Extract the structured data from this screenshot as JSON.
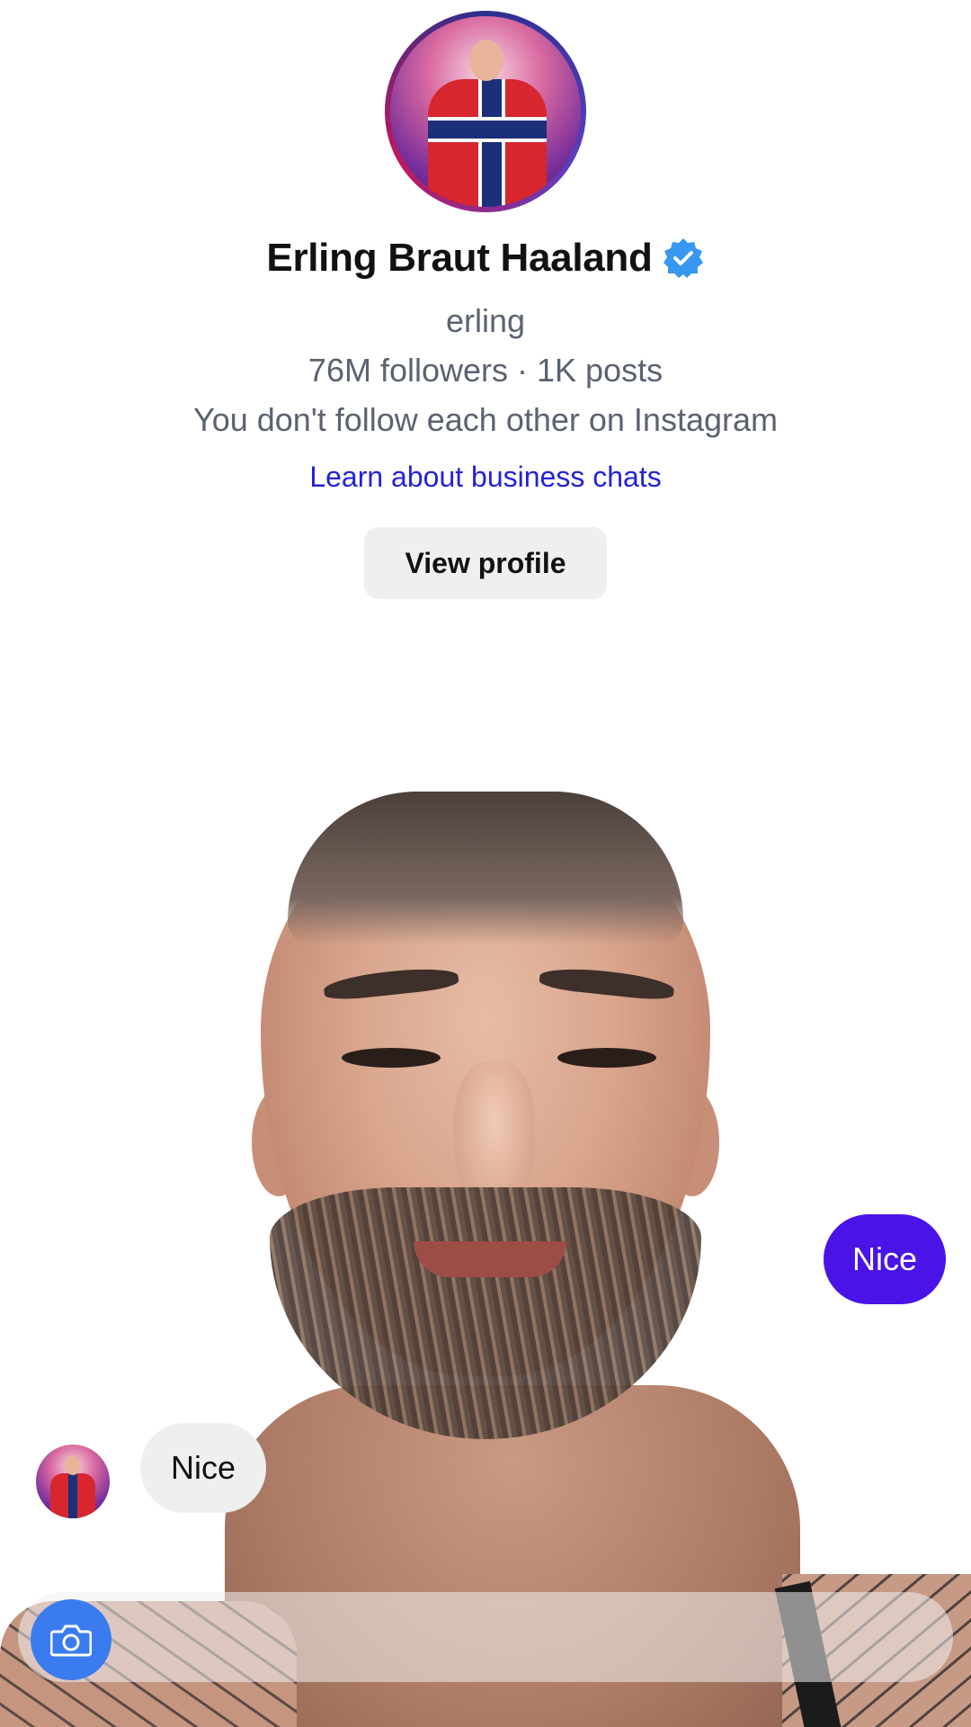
{
  "profile": {
    "name": "Erling Braut Haaland",
    "username": "erling",
    "stats": "76M followers · 1K posts",
    "follow_note": "You don't follow each other on Instagram",
    "learn_link": "Learn about business chats",
    "view_profile_label": "View profile"
  },
  "messages": {
    "outgoing": [
      "Nice"
    ],
    "incoming": [
      "Nice"
    ]
  },
  "colors": {
    "accent": "#4a14e8",
    "link": "#2323d6",
    "verified": "#3897f0",
    "camera": "#3a7cf0"
  },
  "icons": {
    "verified": "verified-badge-icon",
    "camera": "camera-icon"
  }
}
